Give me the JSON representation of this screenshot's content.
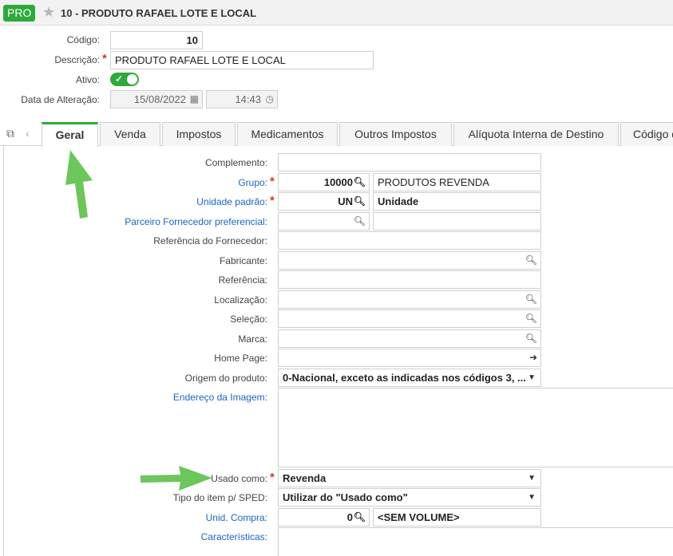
{
  "header": {
    "badge": "PRO",
    "title": "10 - PRODUTO RAFAEL LOTE E LOCAL",
    "star_icon": "star-icon"
  },
  "top_form": {
    "codigo_label": "Código:",
    "codigo_value": "10",
    "descricao_label": "Descrição:",
    "descricao_value": "PRODUTO RAFAEL  LOTE E LOCAL",
    "ativo_label": "Ativo:",
    "ativo_on": true,
    "data_label": "Data de Alteração:",
    "data_value": "15/08/2022",
    "hora_value": "14:43",
    "required_mark": "*"
  },
  "tabs": [
    {
      "label": "Geral",
      "active": true
    },
    {
      "label": "Venda"
    },
    {
      "label": "Impostos"
    },
    {
      "label": "Medicamentos"
    },
    {
      "label": "Outros Impostos"
    },
    {
      "label": "Alíquota Interna de Destino"
    },
    {
      "label": "Código d"
    }
  ],
  "geral": {
    "complemento_label": "Complemento:",
    "grupo_label": "Grupo:",
    "grupo_code": "10000",
    "grupo_desc": "PRODUTOS REVENDA",
    "unidade_label": "Unidade padrão:",
    "unidade_code": "UN",
    "unidade_desc": "Unidade",
    "parceiro_label": "Parceiro Fornecedor preferencial:",
    "referencia_fornecedor_label": "Referência do Fornecedor:",
    "fabricante_label": "Fabricante:",
    "referencia_label": "Referência:",
    "localizacao_label": "Localização:",
    "selecao_label": "Seleção:",
    "marca_label": "Marca:",
    "homepage_label": "Home Page:",
    "origem_label": "Origem do produto:",
    "origem_value": "0-Nacional, exceto as indicadas nos códigos 3, ...",
    "endereco_imagem_label": "Endereço da Imagem:",
    "usado_como_label": "Usado como:",
    "usado_como_value": "Revenda",
    "tipo_item_label": "Tipo do item p/ SPED:",
    "tipo_item_value": "Utilizar do \"Usado como\"",
    "unid_compra_label": "Unid. Compra:",
    "unid_compra_code": "0",
    "unid_compra_desc": "<SEM VOLUME>",
    "caracteristicas_label": "Características:"
  },
  "colors": {
    "accent_green": "#2eaa3a",
    "link_blue": "#1a66c4",
    "required_red": "#d9362b",
    "annotation_arrow": "#6cc65c"
  }
}
